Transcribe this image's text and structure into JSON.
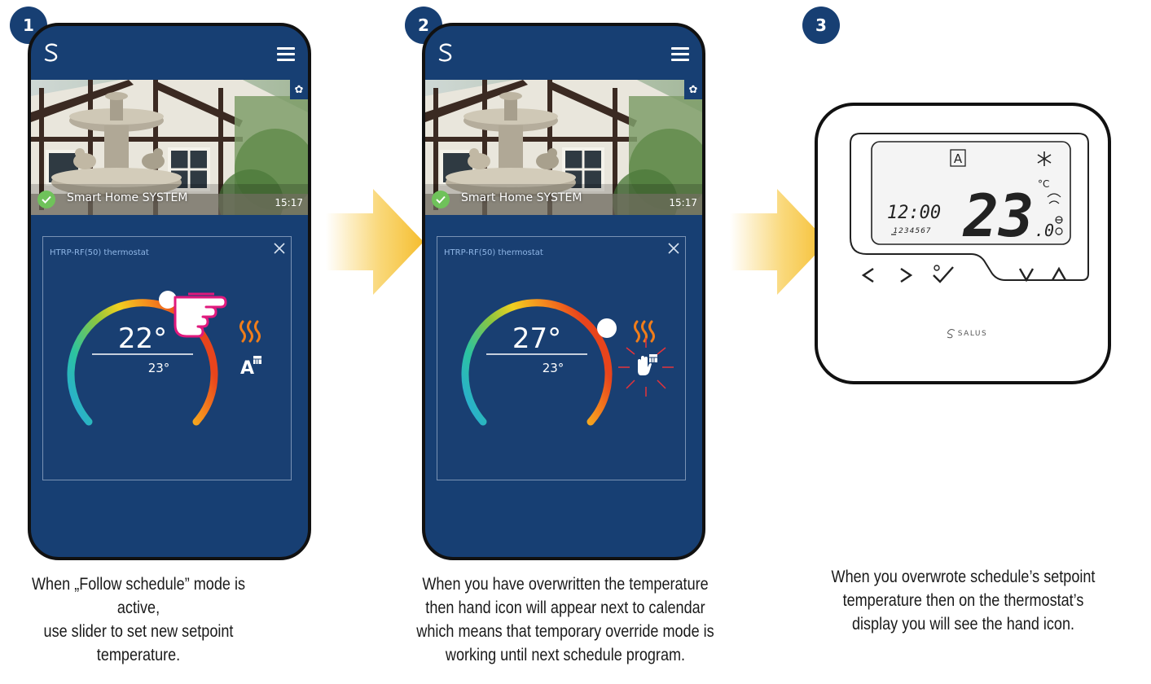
{
  "steps": [
    {
      "number": "1",
      "app": {
        "system_name": "Smart Home SYSTEM",
        "time": "15:17",
        "card_title": "HTRP-RF(50) thermostat",
        "setpoint": "22°",
        "current": "23°",
        "mode_icon": "auto-schedule-icon"
      },
      "caption": [
        "When „Follow schedule” mode is active,",
        "use slider to set new setpoint",
        "temperature."
      ]
    },
    {
      "number": "2",
      "app": {
        "system_name": "Smart Home SYSTEM",
        "time": "15:17",
        "card_title": "HTRP-RF(50) thermostat",
        "setpoint": "27°",
        "current": "23°",
        "mode_icon": "hand-override-icon"
      },
      "caption": [
        "When you have overwritten the temperature",
        "then hand icon will appear next to calendar",
        "which means that temporary override mode is",
        "working until next schedule program."
      ]
    },
    {
      "number": "3",
      "device": {
        "mode_letter": "A",
        "clock": "12:00",
        "days": "1234567",
        "temperature": "23",
        "decimal": ".0",
        "unit": "°C",
        "brand": "SALUS"
      },
      "caption": [
        "When you overwrote schedule’s setpoint",
        "temperature then on the thermostat’s",
        "display you will see the hand icon."
      ]
    }
  ],
  "colors": {
    "app_blue": "#173f73",
    "badge_blue": "#173f73",
    "heat_orange": "#f07d1a",
    "arrow_yellow": "#f7c740",
    "touch_pink": "#e0197d",
    "flash_red": "#e5333a",
    "check_green": "#6fc25a"
  }
}
